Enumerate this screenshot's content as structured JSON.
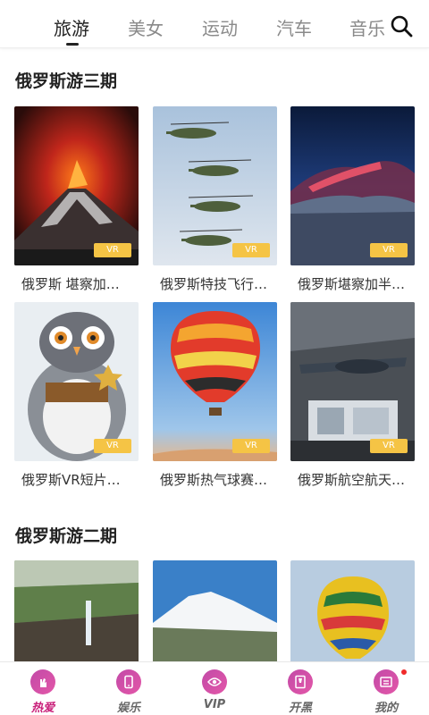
{
  "tabs": [
    {
      "label": "旅游",
      "active": true
    },
    {
      "label": "美女",
      "active": false
    },
    {
      "label": "运动",
      "active": false
    },
    {
      "label": "汽车",
      "active": false
    },
    {
      "label": "音乐",
      "active": false
    }
  ],
  "search_icon": "search-icon",
  "sections": [
    {
      "title": "俄罗斯游三期",
      "items": [
        {
          "caption": "俄罗斯 堪察加…",
          "badge": "VR"
        },
        {
          "caption": "俄罗斯特技飞行…",
          "badge": "VR"
        },
        {
          "caption": "俄罗斯堪察加半…",
          "badge": "VR"
        },
        {
          "caption": "俄罗斯VR短片…",
          "badge": "VR"
        },
        {
          "caption": "俄罗斯热气球赛…",
          "badge": "VR"
        },
        {
          "caption": "俄罗斯航空航天…",
          "badge": "VR"
        }
      ]
    },
    {
      "title": "俄罗斯游二期",
      "items": [
        {},
        {},
        {}
      ]
    }
  ],
  "bottom_nav": [
    {
      "label": "热爱",
      "icon": "hand-icon",
      "active": true
    },
    {
      "label": "娱乐",
      "icon": "phone-icon",
      "active": false
    },
    {
      "label": "VIP",
      "icon": "vip-icon",
      "active": false
    },
    {
      "label": "开黑",
      "icon": "game-icon",
      "active": false
    },
    {
      "label": "我的",
      "icon": "profile-icon",
      "active": false,
      "notification": true
    }
  ],
  "colors": {
    "accent": "#c9207a",
    "badge": "#f5c445",
    "nav_icon": "#d24fa8"
  }
}
